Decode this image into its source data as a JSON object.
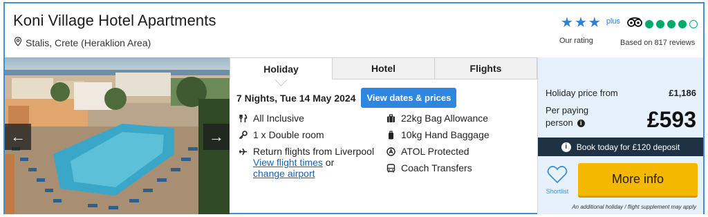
{
  "hotel": {
    "name": "Koni Village Hotel Apartments",
    "location": "Stalis, Crete (Heraklion Area)"
  },
  "rating": {
    "stars": 3,
    "plus_label": "plus",
    "label": "Our rating"
  },
  "tripadvisor": {
    "score": 4,
    "max": 5,
    "label": "Based on 817 reviews"
  },
  "photo": {
    "prev_icon": "arrow-left-icon",
    "next_icon": "arrow-right-icon"
  },
  "tabs": [
    {
      "label": "Holiday",
      "active": true
    },
    {
      "label": "Hotel",
      "active": false
    },
    {
      "label": "Flights",
      "active": false
    }
  ],
  "stay": {
    "summary": "7 Nights, Tue 14 May 2024",
    "dates_button": "View dates & prices"
  },
  "features_left": {
    "board": "All Inclusive",
    "room": "1 x Double room",
    "flights": "Return flights from Liverpool",
    "view_flight_times": "View flight times",
    "or_text": " or",
    "change_airport": "change airport"
  },
  "features_right": {
    "bag": "22kg Bag Allowance",
    "hand": "10kg Hand Baggage",
    "atol": "ATOL Protected",
    "transfers": "Coach Transfers"
  },
  "price": {
    "from_label": "Holiday price from",
    "from_value": "£1,186",
    "per_person_label": "Per paying person",
    "per_person_value": "£593",
    "deposit_text": "Book today for £120 deposit",
    "shortlist_label": "Shortlist",
    "more_info": "More info",
    "supplement_note": "An additional holiday / flight supplement may apply"
  },
  "colors": {
    "accent": "#2f86e0",
    "cta": "#f5b800",
    "deposit_bar": "#1f3244",
    "tripadvisor": "#00aa6c"
  }
}
